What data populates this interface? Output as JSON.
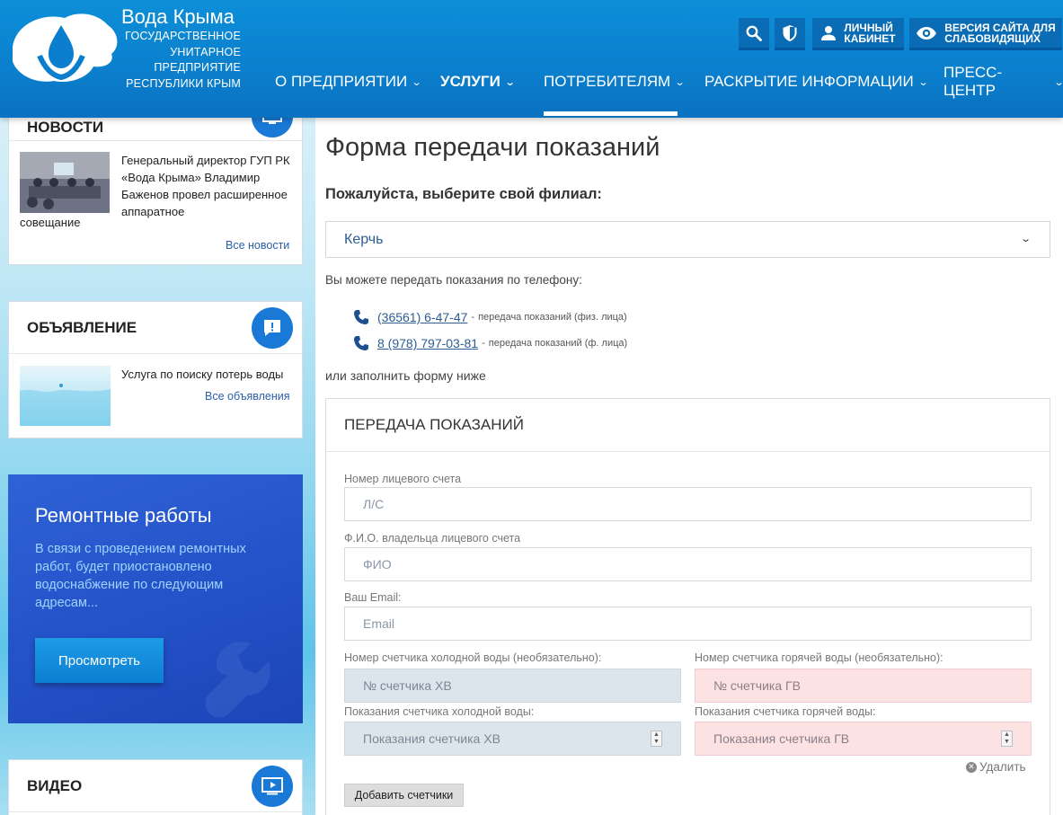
{
  "header": {
    "brand_title": "Вода Крыма",
    "brand_sub_lines": [
      "ГОСУДАРСТВЕННОЕ",
      "УНИТАРНОЕ",
      "ПРЕДПРИЯТИЕ",
      "РЕСПУБЛИКИ КРЫМ"
    ],
    "account_label_1": "ЛИЧНЫЙ",
    "account_label_2": "КАБИНЕТ",
    "vision_label_1": "ВЕРСИЯ САЙТА ДЛЯ",
    "vision_label_2": "СЛАБОВИДЯЩИХ",
    "nav": [
      {
        "label": "О ПРЕДПРИЯТИИ"
      },
      {
        "label": "УСЛУГИ"
      },
      {
        "label": "ПОТРЕБИТЕЛЯМ"
      },
      {
        "label": "РАСКРЫТИЕ ИНФОРМАЦИИ"
      },
      {
        "label": "ПРЕСС-ЦЕНТР"
      }
    ],
    "chevron": "⌄"
  },
  "sidebar": {
    "news": {
      "title": "НОВОСТИ",
      "item_text": "Генеральный директор ГУП РК «Вода Крыма» Владимир Баженов провел расширенное аппаратное",
      "item_text_tail": "совещание",
      "all_link": "Все новости"
    },
    "announcement": {
      "title": "ОБЪЯВЛЕНИЕ",
      "item_text": "Услуга по поиску потерь воды",
      "all_link": "Все объявления"
    },
    "repair": {
      "title": "Ремонтные работы",
      "text": "В связи с проведением ремонтных работ, будет приостановлено водоснабжение по следующим адресам...",
      "button": "Просмотреть"
    },
    "video": {
      "title": "ВИДЕО"
    }
  },
  "main": {
    "title": "Форма передачи показаний",
    "branch_label": "Пожалуйста, выберите свой филиал:",
    "branch_selected": "Керчь",
    "phone_intro": "Вы можете передать показания по телефону:",
    "phones": [
      {
        "number": "(36561) 6-47-47",
        "dash": "-",
        "note": "передача показаний (физ. лица)"
      },
      {
        "number": "8 (978) 797-03-81",
        "dash": "-",
        "note": "передача показаний (ф. лица)"
      }
    ],
    "or_text": "или заполнить форму ниже",
    "form": {
      "title": "ПЕРЕДАЧА ПОКАЗАНИЙ",
      "account_label": "Номер лицевого счета",
      "account_placeholder": "Л/С",
      "owner_label": "Ф.И.О. владельца лицевого счета",
      "owner_placeholder": "ФИО",
      "email_label": "Ваш Email:",
      "email_placeholder": "Email",
      "cold_meter_label": "Номер счетчика холодной воды (необязательно):",
      "cold_meter_placeholder": "№ счетчика ХВ",
      "hot_meter_label": "Номер счетчика горячей воды (необязательно):",
      "hot_meter_placeholder": "№ счетчика ГВ",
      "cold_reading_label": "Показания счетчика холодной воды:",
      "cold_reading_placeholder": "Показания счетчика ХВ",
      "hot_reading_label": "Показания счетчика горячей воды:",
      "hot_reading_placeholder": "Показания счетчика ГВ",
      "remove_label": "Удалить",
      "add_button": "Добавить счетчики"
    }
  },
  "colors": {
    "header_blue": "#0b7fcd",
    "accent_blue": "#1a78d6",
    "link": "#2c5d94",
    "cold_field": "#dde5ec",
    "hot_field": "#fde2e4"
  },
  "icons": [
    "logo-icon",
    "search-icon",
    "shield-icon",
    "user-icon",
    "eye-icon",
    "chevron-down-icon",
    "monitor-icon",
    "chat-alert-icon",
    "video-play-icon",
    "phone-icon",
    "wrench-icon",
    "close-circle-icon",
    "spinner-arrows-icon"
  ]
}
